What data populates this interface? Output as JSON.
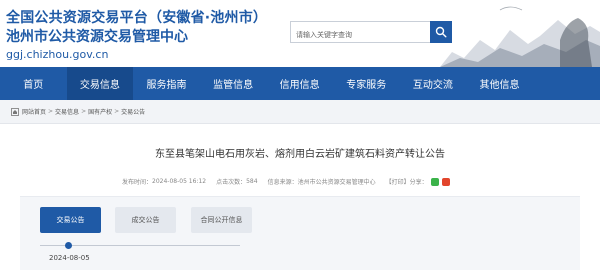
{
  "header": {
    "title_line1": "全国公共资源交易平台（安徽省·池州市）",
    "title_line2": "池州市公共资源交易管理中心",
    "domain": "ggj.chizhou.gov.cn"
  },
  "search": {
    "placeholder": "请输入关键字查询"
  },
  "nav": {
    "items": [
      {
        "label": "首页"
      },
      {
        "label": "交易信息"
      },
      {
        "label": "服务指南"
      },
      {
        "label": "监管信息"
      },
      {
        "label": "信用信息"
      },
      {
        "label": "专家服务"
      },
      {
        "label": "互动交流"
      },
      {
        "label": "其他信息"
      },
      {
        "label": ""
      }
    ],
    "active_index": 1
  },
  "breadcrumb": {
    "items": [
      "网站首页",
      "交易信息",
      "国有产权",
      "交易公告"
    ],
    "separator": ">"
  },
  "article": {
    "title": "东至县笔架山电石用灰岩、熔剂用白云岩矿建筑石料资产转让公告",
    "publish_label": "发布时间：",
    "publish_time": "2024-08-05 16:12",
    "views_label": "点击次数：",
    "views": "584",
    "source_label": "信息来源：",
    "source": "池州市公共资源交易管理中心",
    "print_label": "【打印】",
    "share_label": "分享："
  },
  "tabs": {
    "items": [
      {
        "label": "交易公告"
      },
      {
        "label": "成交公告"
      },
      {
        "label": "合同公开信息"
      }
    ],
    "active_index": 0
  },
  "timeline": {
    "date": "2024-08-05"
  },
  "colors": {
    "brand": "#1f5aa6",
    "nav_active": "#174a8c",
    "share_wechat": "#3bb34a",
    "share_weibo": "#e2452c"
  }
}
